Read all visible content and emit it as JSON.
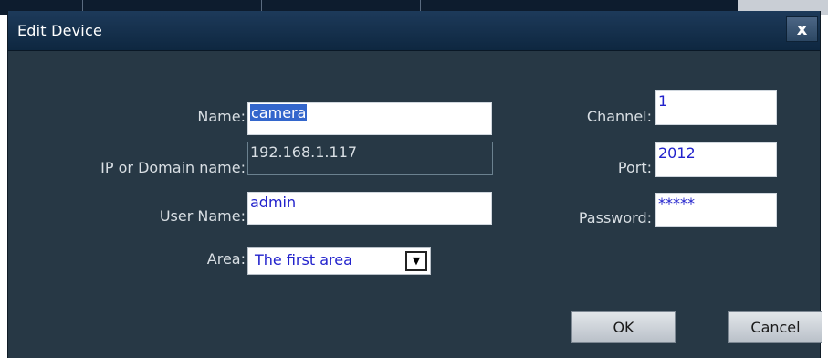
{
  "dialog": {
    "title": "Edit Device",
    "close_label": "x"
  },
  "form": {
    "name": {
      "label": "Name:",
      "value": "camera"
    },
    "ip": {
      "label": "IP or Domain name:",
      "value": "192.168.1.117"
    },
    "username": {
      "label": "User Name:",
      "value": "admin"
    },
    "area": {
      "label": "Area:",
      "value": "The first area"
    },
    "channel": {
      "label": "Channel:",
      "value": "1"
    },
    "port": {
      "label": "Port:",
      "value": "2012"
    },
    "password": {
      "label": "Password:",
      "value": "*****"
    }
  },
  "buttons": {
    "ok": "OK",
    "cancel": "Cancel"
  },
  "colors": {
    "dialog_bg": "#273845",
    "title_bar": "#0e2740",
    "field_text": "#2222cc",
    "selection": "#3366cc"
  }
}
